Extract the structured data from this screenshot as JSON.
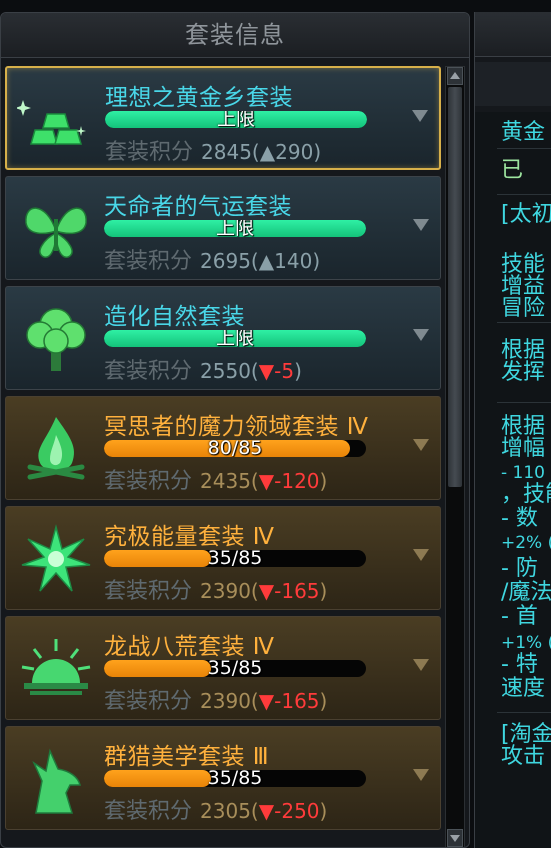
{
  "panel": {
    "title": "套装信息"
  },
  "sets": [
    {
      "name": "理想之黄金乡套装",
      "bar_text": "上限",
      "progress": 1.0,
      "bar_color": "green",
      "style": "max",
      "selected": true,
      "score_label": "套装积分",
      "score": "2845",
      "paren_open": "(",
      "delta_sign": "▲",
      "delta": "290",
      "paren_close": ")",
      "delta_dir": "up",
      "icon": "gold-bars-icon"
    },
    {
      "name": "天命者的气运套装",
      "bar_text": "上限",
      "progress": 1.0,
      "bar_color": "green",
      "style": "max",
      "selected": false,
      "score_label": "套装积分",
      "score": "2695",
      "paren_open": "(",
      "delta_sign": "▲",
      "delta": "140",
      "paren_close": ")",
      "delta_dir": "up",
      "icon": "butterfly-icon"
    },
    {
      "name": "造化自然套装",
      "bar_text": "上限",
      "progress": 1.0,
      "bar_color": "green",
      "style": "max",
      "selected": false,
      "score_label": "套装积分",
      "score": "2550",
      "paren_open": "(",
      "delta_sign": "▼",
      "delta": "-5",
      "paren_close": ")",
      "delta_dir": "down",
      "icon": "tree-icon"
    },
    {
      "name": "冥思者的魔力领域套装 Ⅳ",
      "bar_text": "80/85",
      "progress": 0.94,
      "bar_color": "orange",
      "style": "gold",
      "selected": false,
      "score_label": "套装积分",
      "score": "2435",
      "paren_open": "(",
      "delta_sign": "▼",
      "delta": "-120",
      "paren_close": ")",
      "delta_dir": "down",
      "icon": "campfire-icon"
    },
    {
      "name": "究极能量套装 Ⅳ",
      "bar_text": "35/85",
      "progress": 0.41,
      "bar_color": "orange",
      "style": "gold",
      "selected": false,
      "score_label": "套装积分",
      "score": "2390",
      "paren_open": "(",
      "delta_sign": "▼",
      "delta": "-165",
      "paren_close": ")",
      "delta_dir": "down",
      "icon": "energy-burst-icon"
    },
    {
      "name": "龙战八荒套装 Ⅳ",
      "bar_text": "35/85",
      "progress": 0.41,
      "bar_color": "orange",
      "style": "gold",
      "selected": false,
      "score_label": "套装积分",
      "score": "2390",
      "paren_open": "(",
      "delta_sign": "▼",
      "delta": "-165",
      "paren_close": ")",
      "delta_dir": "down",
      "icon": "rising-sun-icon"
    },
    {
      "name": "群猎美学套装 Ⅲ",
      "bar_text": "35/85",
      "progress": 0.41,
      "bar_color": "orange",
      "style": "gold",
      "selected": false,
      "score_label": "套装积分",
      "score": "2305",
      "paren_open": "(",
      "delta_sign": "▼",
      "delta": "-250",
      "paren_close": ")",
      "delta_dir": "down",
      "icon": "wolf-icon"
    }
  ],
  "right_panel": {
    "lines": [
      {
        "text": "黄金",
        "cls": ""
      },
      {
        "text": "已",
        "cls": "g"
      },
      {
        "text": "[太初",
        "cls": ""
      },
      {
        "text": "技能",
        "cls": ""
      },
      {
        "text": "增益",
        "cls": ""
      },
      {
        "text": "冒险",
        "cls": ""
      },
      {
        "text": "根据",
        "cls": ""
      },
      {
        "text": "发挥",
        "cls": ""
      },
      {
        "text": "根据",
        "cls": ""
      },
      {
        "text": "增幅",
        "cls": ""
      },
      {
        "text": "- 110",
        "cls": "small"
      },
      {
        "text": "，技能",
        "cls": ""
      },
      {
        "text": "- 数",
        "cls": ""
      },
      {
        "text": "+2% (",
        "cls": "small"
      },
      {
        "text": "- 防",
        "cls": ""
      },
      {
        "text": "/魔法",
        "cls": ""
      },
      {
        "text": "- 首",
        "cls": ""
      },
      {
        "text": "+1% (",
        "cls": "small"
      },
      {
        "text": "- 特",
        "cls": ""
      },
      {
        "text": "速度",
        "cls": ""
      },
      {
        "text": "[淘金",
        "cls": ""
      },
      {
        "text": "攻击",
        "cls": ""
      }
    ]
  },
  "colors": {
    "accent_cyan": "#49d7e8",
    "accent_orange": "#ffb13d",
    "bar_green": "#2ff0a4",
    "bar_orange": "#ffa21c",
    "down_red": "#ff3b3b"
  }
}
